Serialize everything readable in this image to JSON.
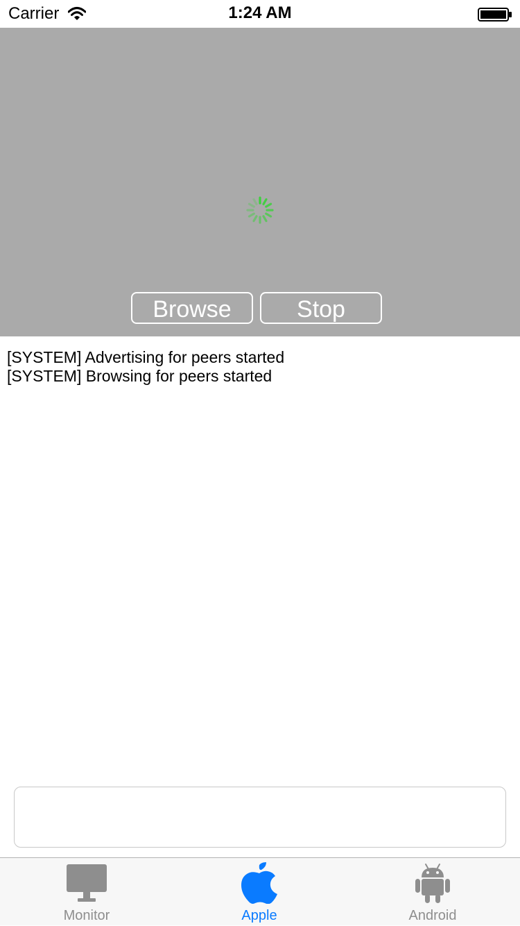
{
  "status_bar": {
    "carrier": "Carrier",
    "time": "1:24 AM"
  },
  "controls": {
    "browse_label": "Browse",
    "stop_label": "Stop",
    "panel_color": "#aaaaaa",
    "spinner_color": "#3bd23b"
  },
  "log": {
    "lines": [
      "[SYSTEM] Advertising for peers started",
      "[SYSTEM] Browsing for peers started"
    ]
  },
  "message_input": {
    "value": "",
    "placeholder": ""
  },
  "tab_bar": {
    "active_color": "#0a7bff",
    "inactive_color": "#8e8e8e",
    "tabs": [
      {
        "label": "Monitor",
        "icon": "monitor-icon",
        "active": false
      },
      {
        "label": "Apple",
        "icon": "apple-icon",
        "active": true
      },
      {
        "label": "Android",
        "icon": "android-icon",
        "active": false
      }
    ]
  }
}
